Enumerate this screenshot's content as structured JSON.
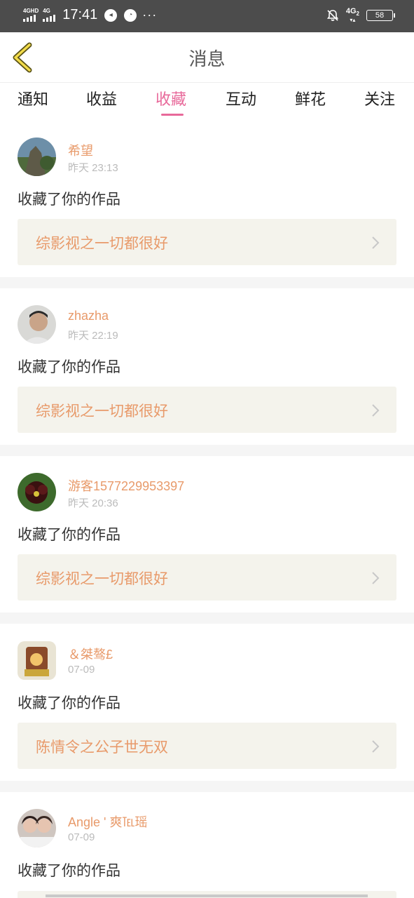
{
  "status_bar": {
    "net1": "4GHD",
    "net2": "4G",
    "time": "17:41",
    "dots": "···",
    "sig": "4G",
    "sig_sub": "2",
    "battery": "58"
  },
  "header": {
    "title": "消息"
  },
  "tabs": [
    {
      "label": "通知"
    },
    {
      "label": "收益"
    },
    {
      "label": "收藏"
    },
    {
      "label": "互动"
    },
    {
      "label": "鲜花"
    },
    {
      "label": "关注"
    }
  ],
  "active_tab": "收藏",
  "colors": {
    "accent": "#e8699a",
    "name": "#e89a6a",
    "work_bg": "#f4f3ec"
  },
  "items": [
    {
      "name": "希望",
      "time": "昨天 23:13",
      "action": "收藏了你的作品",
      "work": "综影视之一切都很好"
    },
    {
      "name": "zhazha",
      "time": "昨天 22:19",
      "action": "收藏了你的作品",
      "work": "综影视之一切都很好"
    },
    {
      "name": "游客1577229953397",
      "time": "昨天 20:36",
      "action": "收藏了你的作品",
      "work": "综影视之一切都很好"
    },
    {
      "name": "＆桀骜£",
      "time": "07-09",
      "action": "收藏了你的作品",
      "work": "陈情令之公子世无双"
    },
    {
      "name": "Angle ' 爽℡瑶",
      "time": "07-09",
      "action": "收藏了你的作品",
      "work": ""
    }
  ]
}
